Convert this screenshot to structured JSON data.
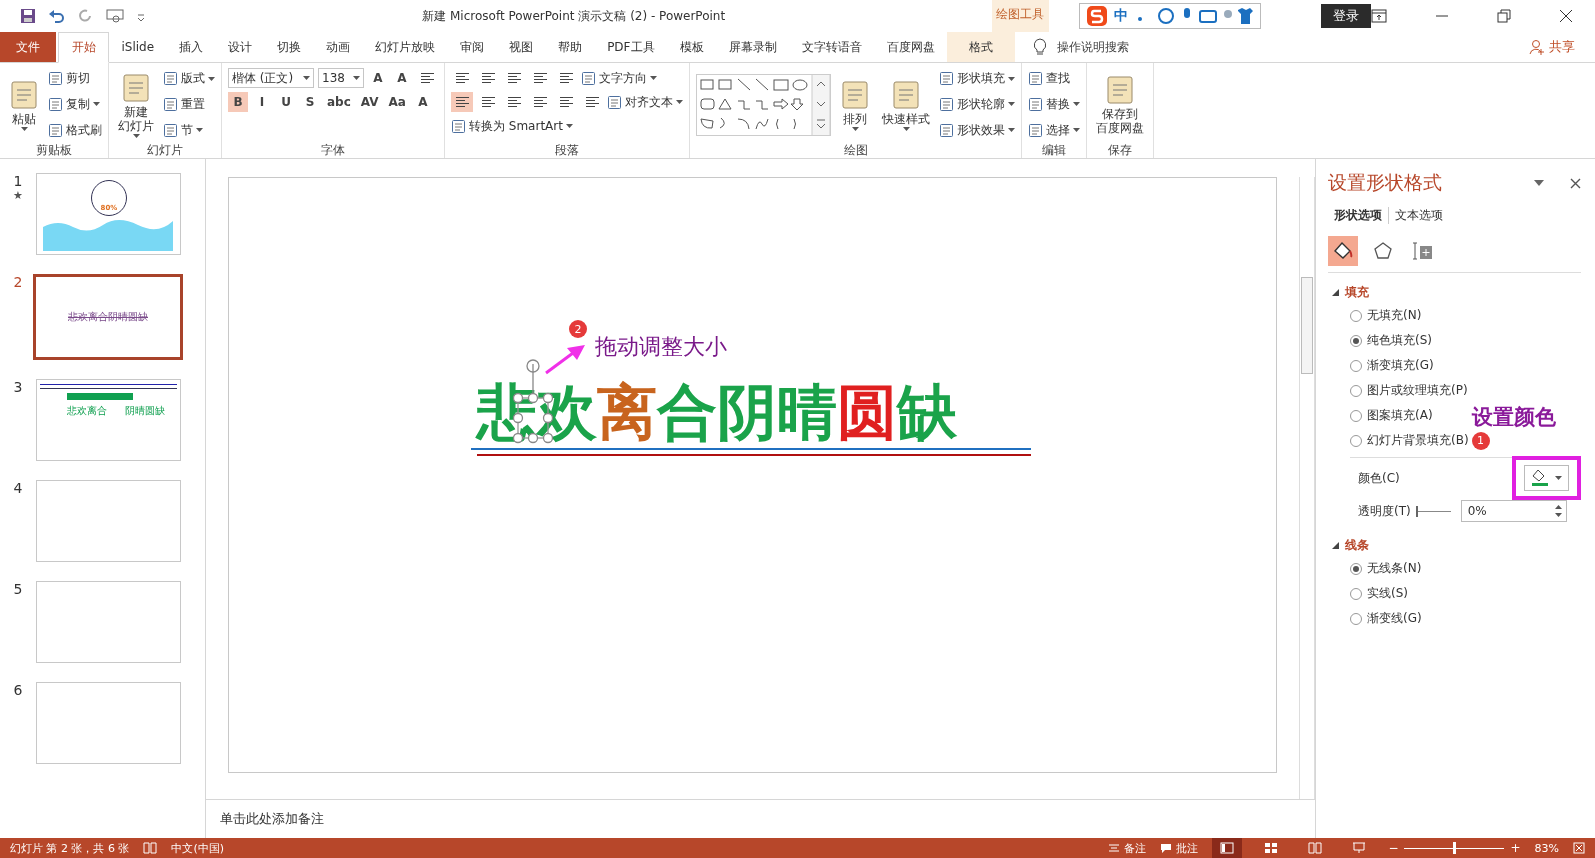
{
  "window": {
    "title": "新建 Microsoft PowerPoint 演示文稿 (2)  -  PowerPoint",
    "context_group": "绘图工具",
    "ime": {
      "label": "中"
    },
    "login": "登录"
  },
  "tabs": [
    {
      "label": "文件",
      "kind": "file",
      "selected": false
    },
    {
      "label": "开始",
      "kind": "tab",
      "selected": true
    },
    {
      "label": "iSlide",
      "kind": "tab",
      "selected": false
    },
    {
      "label": "插入",
      "kind": "tab",
      "selected": false
    },
    {
      "label": "设计",
      "kind": "tab",
      "selected": false
    },
    {
      "label": "切换",
      "kind": "tab",
      "selected": false
    },
    {
      "label": "动画",
      "kind": "tab",
      "selected": false
    },
    {
      "label": "幻灯片放映",
      "kind": "tab",
      "selected": false
    },
    {
      "label": "审阅",
      "kind": "tab",
      "selected": false
    },
    {
      "label": "视图",
      "kind": "tab",
      "selected": false
    },
    {
      "label": "帮助",
      "kind": "tab",
      "selected": false
    },
    {
      "label": "PDF工具",
      "kind": "tab",
      "selected": false
    },
    {
      "label": "模板",
      "kind": "tab",
      "selected": false
    },
    {
      "label": "屏幕录制",
      "kind": "tab",
      "selected": false
    },
    {
      "label": "文字转语音",
      "kind": "tab",
      "selected": false
    },
    {
      "label": "百度网盘",
      "kind": "tab",
      "selected": false
    },
    {
      "label": "格式",
      "kind": "context",
      "selected": false
    }
  ],
  "tell_me": {
    "placeholder": "操作说明搜索"
  },
  "share": "共享",
  "ribbon": [
    {
      "label": "剪贴板",
      "columns": [
        [
          {
            "kind": "large",
            "lines": [
              "粘贴"
            ],
            "dropdown": true
          }
        ],
        [
          {
            "kind": "small",
            "label": "剪切",
            "dropdown": false
          },
          {
            "kind": "small",
            "label": "复制",
            "dropdown": true
          },
          {
            "kind": "small",
            "label": "格式刷",
            "dropdown": false
          }
        ]
      ]
    },
    {
      "label": "幻灯片",
      "columns": [
        [
          {
            "kind": "large",
            "lines": [
              "新建",
              "幻灯片"
            ],
            "dropdown": true
          }
        ],
        [
          {
            "kind": "small",
            "label": "版式",
            "dropdown": true
          },
          {
            "kind": "small",
            "label": "重置",
            "dropdown": false
          },
          {
            "kind": "small",
            "label": "节",
            "dropdown": true
          }
        ]
      ]
    },
    {
      "label": "字体",
      "columns": [
        [
          {
            "kind": "field",
            "label": "楷体 (正文)"
          },
          {
            "kind": "field",
            "label": "138"
          },
          {
            "kind": "toggle",
            "label": "A",
            "selected": false
          },
          {
            "kind": "toggle",
            "label": "A",
            "selected": false
          },
          {
            "kind": "iconbtn",
            "selected": false
          }
        ],
        [
          {
            "kind": "toggle",
            "label": "B",
            "selected": true
          },
          {
            "kind": "toggle",
            "label": "I",
            "selected": false
          },
          {
            "kind": "toggle",
            "label": "U",
            "selected": false
          },
          {
            "kind": "toggle",
            "label": "S",
            "selected": false
          },
          {
            "kind": "toggle",
            "label": "abc",
            "selected": false
          },
          {
            "kind": "toggle",
            "label": "AV",
            "selected": false
          },
          {
            "kind": "toggle",
            "label": "Aa",
            "selected": false
          },
          {
            "kind": "toggle",
            "label": "A",
            "selected": false
          }
        ]
      ]
    },
    {
      "label": "段落",
      "columns": [
        [
          {
            "kind": "iconbtn",
            "selected": false
          },
          {
            "kind": "iconbtn",
            "selected": false
          },
          {
            "kind": "iconbtn",
            "selected": false
          },
          {
            "kind": "iconbtn",
            "selected": false
          },
          {
            "kind": "iconbtn",
            "selected": false
          },
          {
            "kind": "small",
            "label": "文字方向",
            "dropdown": true
          }
        ],
        [
          {
            "kind": "iconbtn",
            "selected": true
          },
          {
            "kind": "iconbtn",
            "selected": false
          },
          {
            "kind": "iconbtn",
            "selected": false
          },
          {
            "kind": "iconbtn",
            "selected": false
          },
          {
            "kind": "iconbtn",
            "selected": false
          },
          {
            "kind": "iconbtn",
            "selected": false
          },
          {
            "kind": "small",
            "label": "对齐文本",
            "dropdown": true
          }
        ],
        [
          {
            "kind": "small",
            "label": "转换为 SmartArt",
            "dropdown": true
          }
        ]
      ]
    },
    {
      "label": "绘图",
      "columns": [
        [
          {
            "kind": "gallery"
          }
        ],
        [
          {
            "kind": "large",
            "lines": [
              "排列"
            ],
            "dropdown": true
          }
        ],
        [
          {
            "kind": "large",
            "lines": [
              "快速样式"
            ],
            "dropdown": true
          }
        ],
        [
          {
            "kind": "small",
            "label": "形状填充",
            "dropdown": true
          },
          {
            "kind": "small",
            "label": "形状轮廓",
            "dropdown": true
          },
          {
            "kind": "small",
            "label": "形状效果",
            "dropdown": true
          }
        ]
      ]
    },
    {
      "label": "编辑",
      "columns": [
        [
          {
            "kind": "small",
            "label": "查找",
            "dropdown": false
          },
          {
            "kind": "small",
            "label": "替换",
            "dropdown": true
          },
          {
            "kind": "small",
            "label": "选择",
            "dropdown": true
          }
        ]
      ]
    },
    {
      "label": "保存",
      "columns": [
        [
          {
            "kind": "large",
            "lines": [
              "保存到",
              "百度网盘"
            ],
            "dropdown": false
          }
        ]
      ]
    }
  ],
  "slides": [
    {
      "number": "1",
      "star": "★",
      "selected": false,
      "kind": "wave",
      "texts": [
        "80%"
      ]
    },
    {
      "number": "2",
      "selected": true,
      "kind": "title",
      "texts": [
        "悲欢离合阴晴圆缺"
      ]
    },
    {
      "number": "3",
      "selected": false,
      "kind": "bar",
      "texts": [
        "悲欢离合",
        "阴晴圆缺"
      ]
    },
    {
      "number": "4",
      "selected": false,
      "kind": "blank"
    },
    {
      "number": "5",
      "selected": false,
      "kind": "blank"
    },
    {
      "number": "6",
      "selected": false,
      "kind": "blank"
    }
  ],
  "slide": {
    "characters": [
      {
        "text": "悲",
        "color": "#1aa34a"
      },
      {
        "text": "欢",
        "color": "#1aa34a"
      },
      {
        "text": "离",
        "color": "#c8641e"
      },
      {
        "text": "合",
        "color": "#1aa34a"
      },
      {
        "text": "阴",
        "color": "#1aa34a"
      },
      {
        "text": "晴",
        "color": "#1aa34a"
      },
      {
        "text": "圆",
        "color": "#e02020"
      },
      {
        "text": "缺",
        "color": "#1aa34a"
      }
    ],
    "callout": {
      "badge": "2",
      "text": "拖动调整大小"
    }
  },
  "notes": {
    "placeholder": "单击此处添加备注"
  },
  "pane": {
    "title": "设置形状格式",
    "tabs": [
      {
        "label": "形状选项",
        "selected": true
      },
      {
        "label": "文本选项",
        "selected": false
      }
    ],
    "icon_tabs": [
      {
        "selected": true
      },
      {
        "selected": false
      },
      {
        "selected": false
      }
    ],
    "sections": [
      {
        "title": "填充",
        "expanded": true,
        "options": [
          {
            "label": "无填充(N)",
            "selected": false
          },
          {
            "label": "纯色填充(S)",
            "selected": true
          },
          {
            "label": "渐变填充(G)",
            "selected": false
          },
          {
            "label": "图片或纹理填充(P)",
            "selected": false
          },
          {
            "label": "图案填充(A)",
            "selected": false
          },
          {
            "label": "幻灯片背景填充(B)",
            "selected": false
          }
        ],
        "color": {
          "label": "颜色(C)"
        },
        "transparency": {
          "label": "透明度(T)",
          "level": 0,
          "value": "0%"
        }
      },
      {
        "title": "线条",
        "expanded": true,
        "options": [
          {
            "label": "无线条(N)",
            "selected": true
          },
          {
            "label": "实线(S)",
            "selected": false
          },
          {
            "label": "渐变线(G)",
            "selected": false
          }
        ]
      }
    ],
    "annotation": {
      "badge": "1",
      "text": "设置颜色"
    }
  },
  "status_bar": {
    "slide_info": "幻灯片 第 2 张，共 6 张",
    "language": "中文(中国)",
    "notes": "备注",
    "comments": "批注",
    "zoom": {
      "minus": "−",
      "plus": "+",
      "level": 0.5,
      "value": "83%"
    }
  }
}
